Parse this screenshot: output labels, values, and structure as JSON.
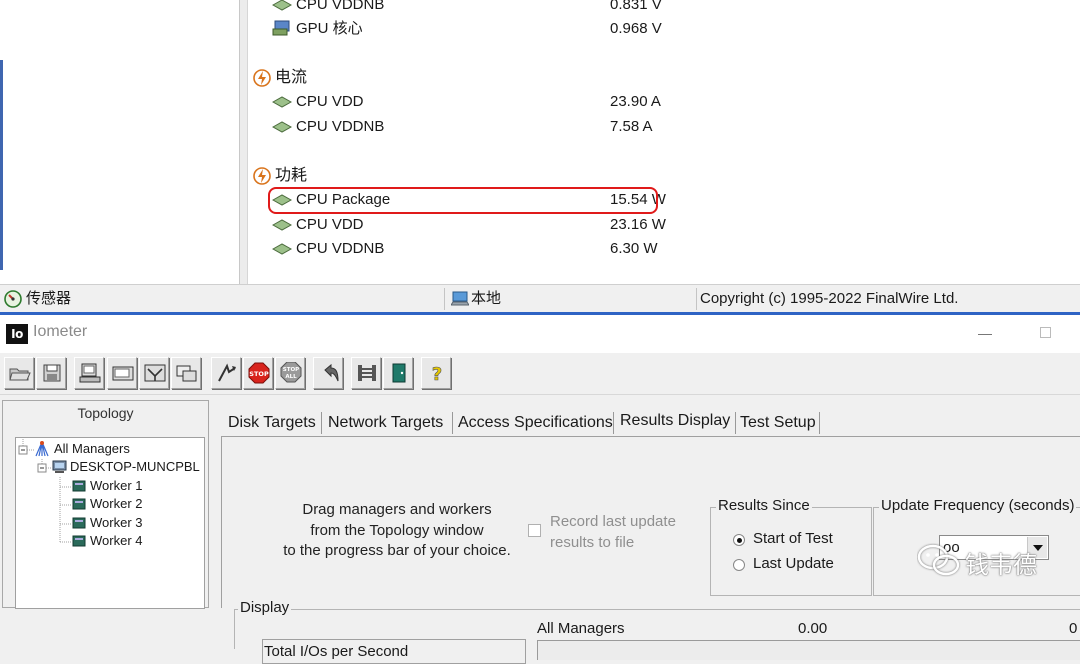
{
  "aida64": {
    "sensors": [
      {
        "kind": "row",
        "label": "CPU VDDNB",
        "value": "0.831 V",
        "icon": "chip-icon"
      },
      {
        "kind": "row",
        "label": "GPU 核心",
        "value": "0.968 V",
        "icon": "gpu-icon"
      },
      {
        "kind": "category",
        "label": "电流",
        "icon": "lightning-icon"
      },
      {
        "kind": "row",
        "label": "CPU VDD",
        "value": "23.90 A",
        "icon": "chip-icon"
      },
      {
        "kind": "row",
        "label": "CPU VDDNB",
        "value": "7.58 A",
        "icon": "chip-icon"
      },
      {
        "kind": "category",
        "label": "功耗",
        "icon": "lightning-icon"
      },
      {
        "kind": "row",
        "label": "CPU Package",
        "value": "15.54 W",
        "icon": "chip-icon",
        "highlighted": true
      },
      {
        "kind": "row",
        "label": "CPU VDD",
        "value": "23.16 W",
        "icon": "chip-icon"
      },
      {
        "kind": "row",
        "label": "CPU VDDNB",
        "value": "6.30 W",
        "icon": "chip-icon"
      }
    ],
    "status_bar": {
      "sensor_label": "传感器",
      "location_label": "本地",
      "copyright": "Copyright (c) 1995-2022 FinalWire Ltd."
    },
    "highlight_color": "#e01a1a"
  },
  "iometer": {
    "title": "Iometer",
    "logo_text": "Io",
    "toolbar": [
      "open-icon",
      "save-icon",
      "start-disk-worker-icon",
      "start-network-worker-icon",
      "add-manager-icon",
      "copy-worker-icon",
      "start-tests-icon",
      "stop-icon",
      "stop-all-icon",
      "reset-workers-icon",
      "disconnect-icon",
      "exit-icon",
      "help-icon"
    ],
    "topology": {
      "title": "Topology",
      "root": "All Managers",
      "manager": "DESKTOP-MUNCPBL",
      "workers": [
        "Worker 1",
        "Worker 2",
        "Worker 3",
        "Worker 4"
      ]
    },
    "tabs": [
      "Disk Targets",
      "Network Targets",
      "Access Specifications",
      "Results Display",
      "Test Setup"
    ],
    "active_tab": "Results Display",
    "results_display": {
      "drag_text": [
        "Drag managers and workers",
        "from the Topology window",
        "to the progress bar of your choice."
      ],
      "record_label": [
        "Record last update",
        "results to file"
      ],
      "record_checked": false,
      "results_since": {
        "legend": "Results Since",
        "options": [
          "Start of Test",
          "Last Update"
        ],
        "selected": "Start of Test"
      },
      "update_frequency": {
        "legend": "Update Frequency (seconds)",
        "value": "oo"
      },
      "display": {
        "legend": "Display",
        "metric": "Total I/Os per Second",
        "manager_label": "All Managers",
        "manager_value": "0.00",
        "right_value": "0"
      }
    }
  },
  "watermark": {
    "text": "钱韦德"
  }
}
